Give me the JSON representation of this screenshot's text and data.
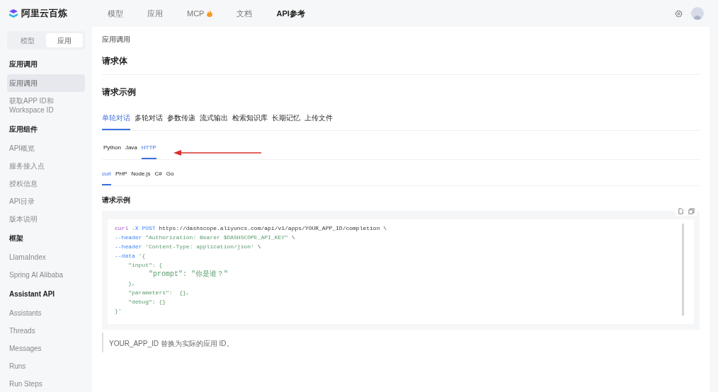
{
  "brand": {
    "name": "阿里云百炼"
  },
  "nav": [
    {
      "label": "模型",
      "selected": false,
      "hot": false
    },
    {
      "label": "应用",
      "selected": false,
      "hot": false
    },
    {
      "label": "MCP",
      "selected": false,
      "hot": true
    },
    {
      "label": "文档",
      "selected": false,
      "hot": false
    },
    {
      "label": "API参考",
      "selected": true,
      "hot": false
    }
  ],
  "sidebar": {
    "switch": [
      {
        "label": "模型",
        "selected": false
      },
      {
        "label": "应用",
        "selected": true
      }
    ],
    "items": [
      {
        "kind": "heading",
        "label": "应用调用"
      },
      {
        "kind": "item",
        "label": "应用调用",
        "selected": true
      },
      {
        "kind": "item",
        "label": "获取APP ID和Workspace ID",
        "selected": false
      },
      {
        "kind": "heading",
        "label": "应用组件"
      },
      {
        "kind": "item",
        "label": "API概览",
        "selected": false
      },
      {
        "kind": "item",
        "label": "服务接入点",
        "selected": false
      },
      {
        "kind": "item",
        "label": "授权信息",
        "selected": false
      },
      {
        "kind": "item",
        "label": "API目录",
        "selected": false
      },
      {
        "kind": "item",
        "label": "版本说明",
        "selected": false
      },
      {
        "kind": "heading",
        "label": "框架"
      },
      {
        "kind": "item",
        "label": "LlamaIndex",
        "selected": false
      },
      {
        "kind": "item",
        "label": "Spring AI Alibaba",
        "selected": false
      },
      {
        "kind": "heading",
        "label": "Assistant API"
      },
      {
        "kind": "item",
        "label": "Assistants",
        "selected": false
      },
      {
        "kind": "item",
        "label": "Threads",
        "selected": false
      },
      {
        "kind": "item",
        "label": "Messages",
        "selected": false
      },
      {
        "kind": "item",
        "label": "Runs",
        "selected": false
      },
      {
        "kind": "item",
        "label": "Run Steps",
        "selected": false
      }
    ]
  },
  "main": {
    "breadcrumb": "应用调用",
    "section_1": "请求体",
    "section_2": "请求示例",
    "scenario_tabs": [
      {
        "label": "单轮对话",
        "selected": true
      },
      {
        "label": "多轮对话",
        "selected": false
      },
      {
        "label": "参数传递",
        "selected": false
      },
      {
        "label": "流式输出",
        "selected": false
      },
      {
        "label": "检索知识库",
        "selected": false
      },
      {
        "label": "长期记忆",
        "selected": false
      },
      {
        "label": "上传文件",
        "selected": false
      }
    ],
    "language_tabs": [
      {
        "label": "Python",
        "selected": false
      },
      {
        "label": "Java",
        "selected": false
      },
      {
        "label": "HTTP",
        "selected": true
      }
    ],
    "client_tabs": [
      {
        "label": "curl",
        "selected": true
      },
      {
        "label": "PHP",
        "selected": false
      },
      {
        "label": "Node.js",
        "selected": false
      },
      {
        "label": "C#",
        "selected": false
      },
      {
        "label": "Go",
        "selected": false
      }
    ],
    "example_title": "请求示例",
    "code_lines": [
      [
        {
          "kind": "command",
          "text": "curl"
        },
        {
          "kind": "flag",
          "text": " -X POST"
        },
        {
          "kind": "plain",
          "text": " https://dashscope.aliyuncs.com/api/v1/apps/YOUR_APP_ID/completion \\"
        }
      ],
      [
        {
          "kind": "flag",
          "text": "--header"
        },
        {
          "kind": "string",
          "text": " \"Authorization: Bearer $DASHSCOPE_API_KEY\""
        },
        {
          "kind": "plain",
          "text": " \\"
        }
      ],
      [
        {
          "kind": "flag",
          "text": "--header"
        },
        {
          "kind": "string",
          "text": " 'Content-Type: application/json'"
        },
        {
          "kind": "plain",
          "text": " \\"
        }
      ],
      [
        {
          "kind": "flag",
          "text": "--data"
        },
        {
          "kind": "string",
          "text": " '{"
        }
      ],
      [
        {
          "kind": "string",
          "text": "    \"input\": {"
        }
      ],
      [
        {
          "kind": "string",
          "text": "        \"prompt\": \"你是谁？\""
        }
      ],
      [
        {
          "kind": "string",
          "text": "    },"
        }
      ],
      [
        {
          "kind": "string",
          "text": "    \"parameters\":  {},"
        }
      ],
      [
        {
          "kind": "string",
          "text": "    \"debug\": {}"
        }
      ],
      [
        {
          "kind": "string",
          "text": "}'"
        }
      ]
    ],
    "note": "YOUR_APP_ID 替换为实际的应用 ID。"
  }
}
